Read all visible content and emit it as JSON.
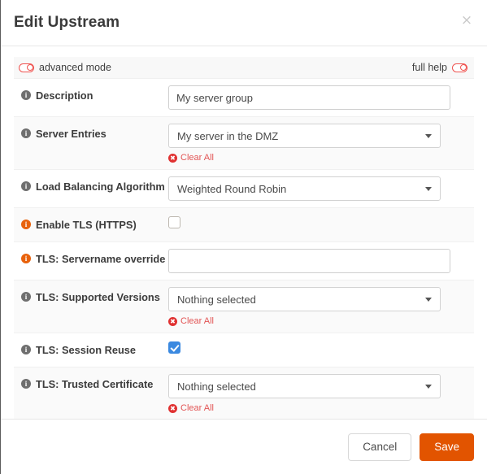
{
  "window": {
    "title": "Edit Upstream",
    "close_label": "×"
  },
  "toolbar": {
    "advanced_mode_label": "advanced mode",
    "full_help_label": "full help",
    "advanced_mode_on": false,
    "full_help_on": false,
    "toggle_color": "#ef5350"
  },
  "colors": {
    "info_default": "#6f6f6f",
    "info_highlight": "#e8620c",
    "clear_all": "#e25555",
    "checkbox_checked": "#3b89e0",
    "save_button": "#e25400",
    "row_alt_bg": "#fafafa"
  },
  "form": {
    "rows": [
      {
        "label": "Description",
        "info": "info-icon",
        "info_variant": "default",
        "control": "text",
        "value": "My server group",
        "placeholder": "",
        "clear_all": null
      },
      {
        "label": "Server Entries",
        "info": "info-icon",
        "info_variant": "default",
        "control": "select",
        "value": "My server in the DMZ",
        "clear_all": "Clear All"
      },
      {
        "label": "Load Balancing Algorithm",
        "info": "info-icon",
        "info_variant": "default",
        "control": "select",
        "value": "Weighted Round Robin",
        "clear_all": null
      },
      {
        "label": "Enable TLS (HTTPS)",
        "info": "info-icon",
        "info_variant": "orange",
        "control": "checkbox",
        "checked": false,
        "clear_all": null
      },
      {
        "label": "TLS: Servername override",
        "info": "info-icon",
        "info_variant": "orange",
        "control": "text",
        "value": "",
        "placeholder": "",
        "clear_all": null
      },
      {
        "label": "TLS: Supported Versions",
        "info": "info-icon",
        "info_variant": "default",
        "control": "select",
        "value": "Nothing selected",
        "clear_all": "Clear All"
      },
      {
        "label": "TLS: Session Reuse",
        "info": "info-icon",
        "info_variant": "default",
        "control": "checkbox",
        "checked": true,
        "clear_all": null
      },
      {
        "label": "TLS: Trusted Certificate",
        "info": "info-icon",
        "info_variant": "default",
        "control": "select",
        "value": "Nothing selected",
        "clear_all": "Clear All"
      }
    ]
  },
  "footer": {
    "cancel_label": "Cancel",
    "save_label": "Save"
  },
  "icons": {
    "info": "i",
    "clear": "✖",
    "close": "×"
  }
}
